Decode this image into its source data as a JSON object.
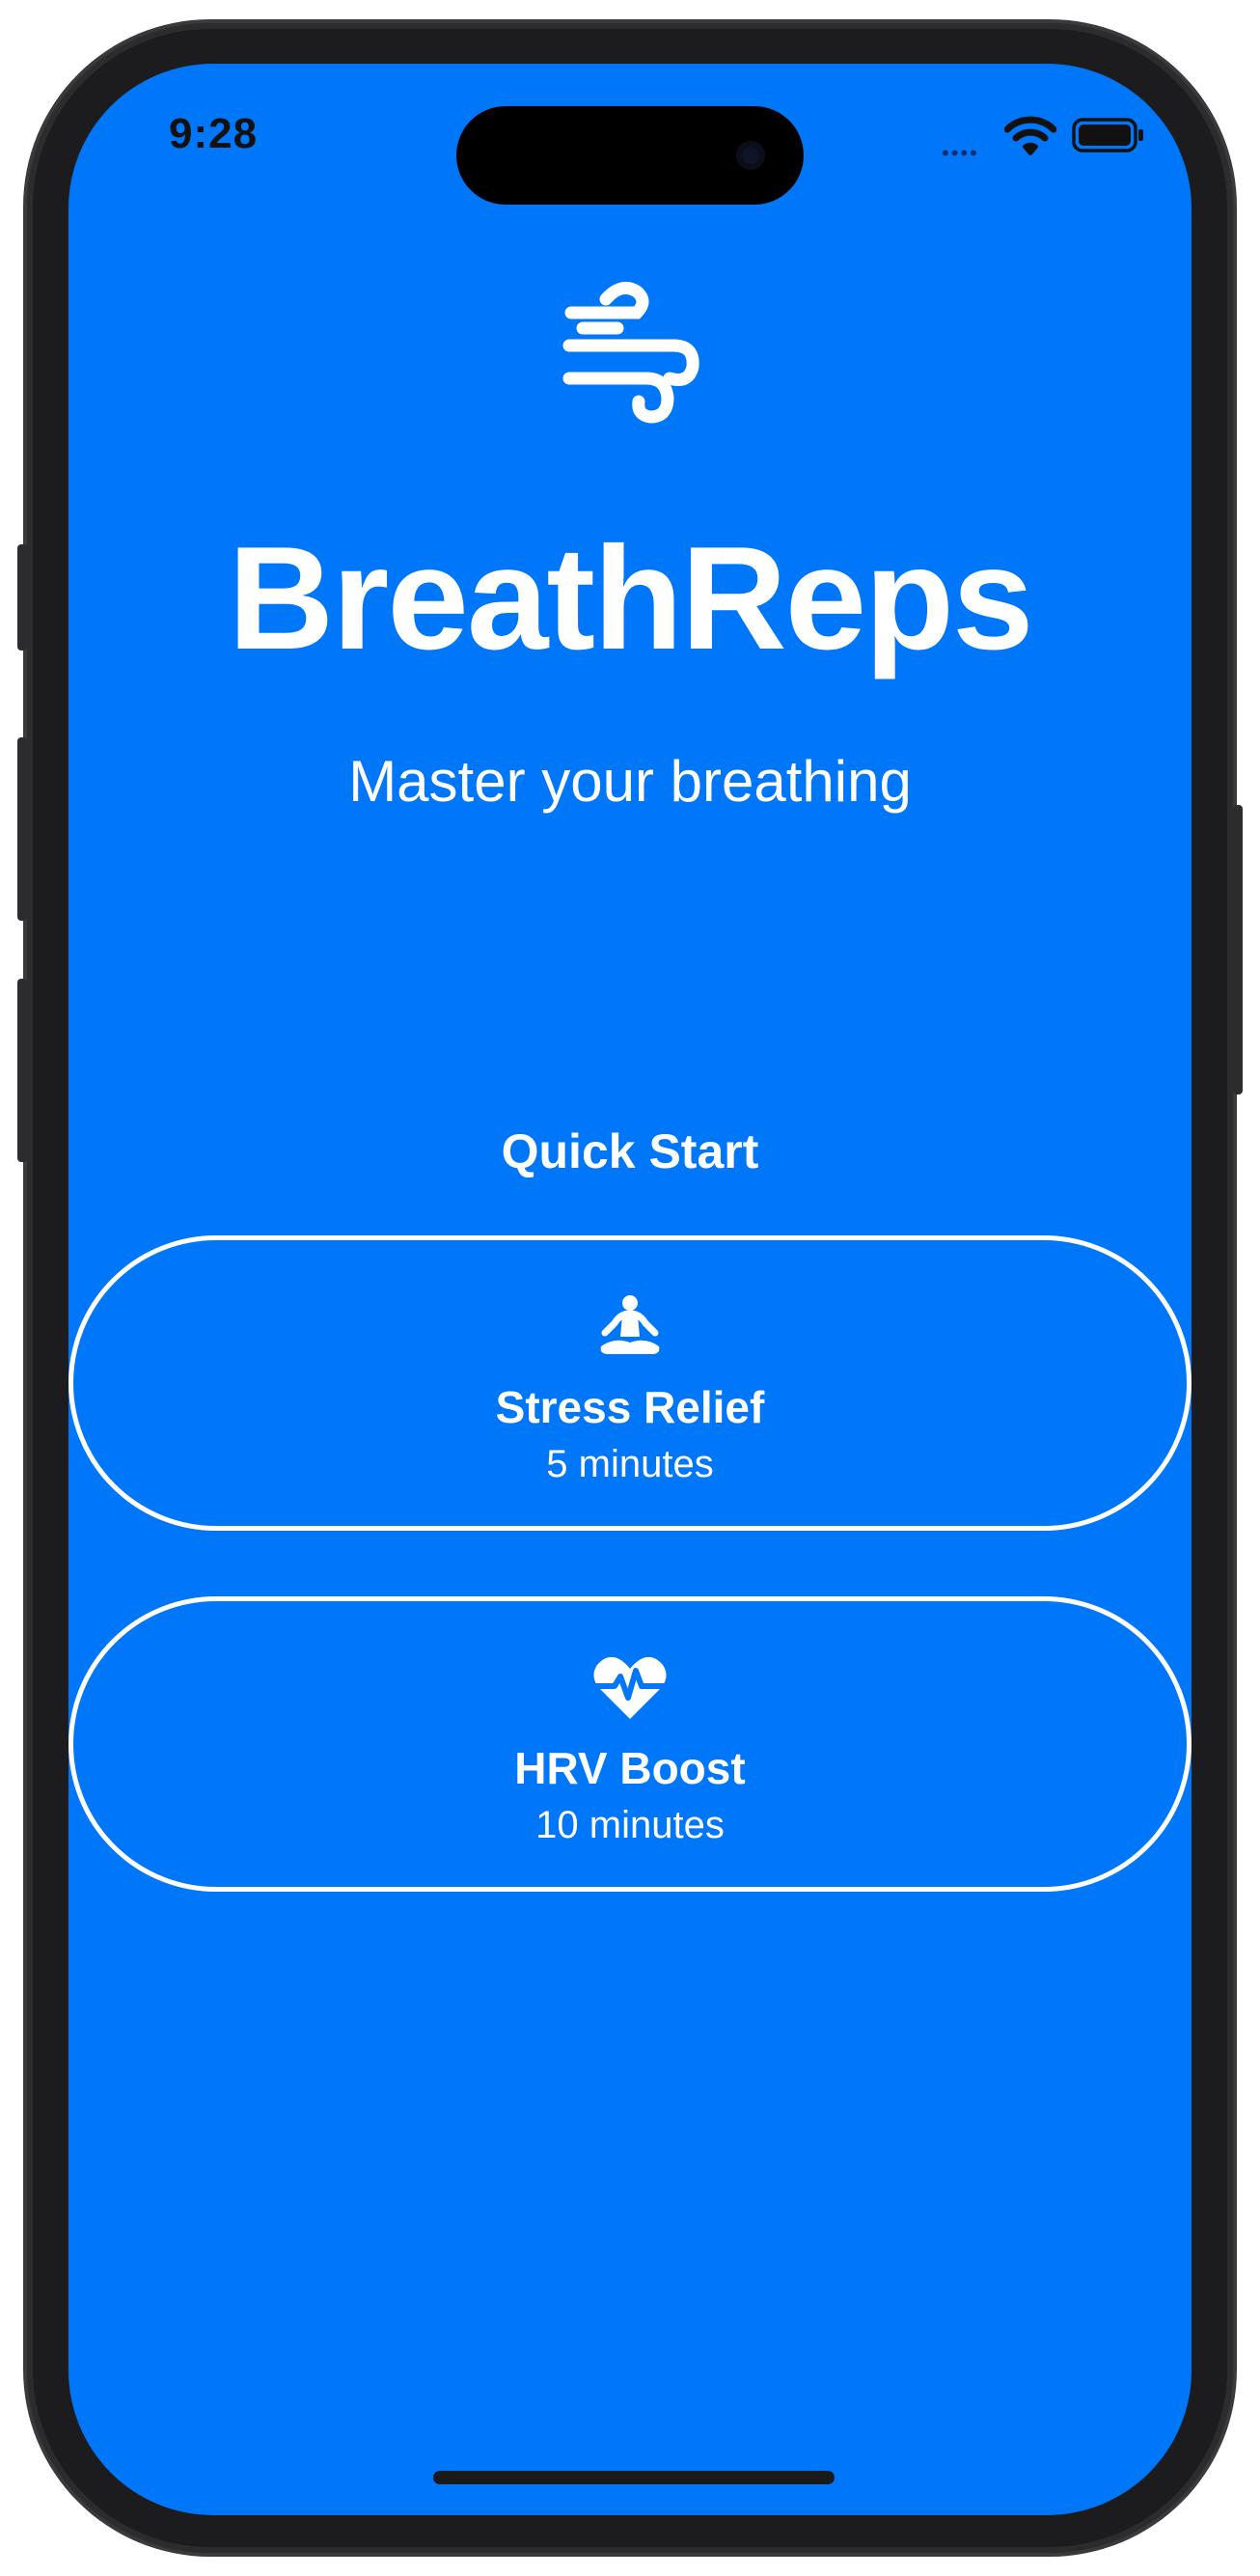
{
  "status_bar": {
    "time": "9:28",
    "signal_dots": "••••"
  },
  "app": {
    "logo_icon": "wind-icon",
    "title": "BreathReps",
    "subtitle": "Master your breathing"
  },
  "quick_start": {
    "heading": "Quick Start",
    "sessions": [
      {
        "icon": "meditation-figure-icon",
        "title": "Stress Relief",
        "duration": "5 minutes"
      },
      {
        "icon": "heart-pulse-icon",
        "title": "HRV Boost",
        "duration": "10 minutes"
      }
    ]
  },
  "colors": {
    "background": "#0076f8",
    "foreground": "#ffffff"
  }
}
